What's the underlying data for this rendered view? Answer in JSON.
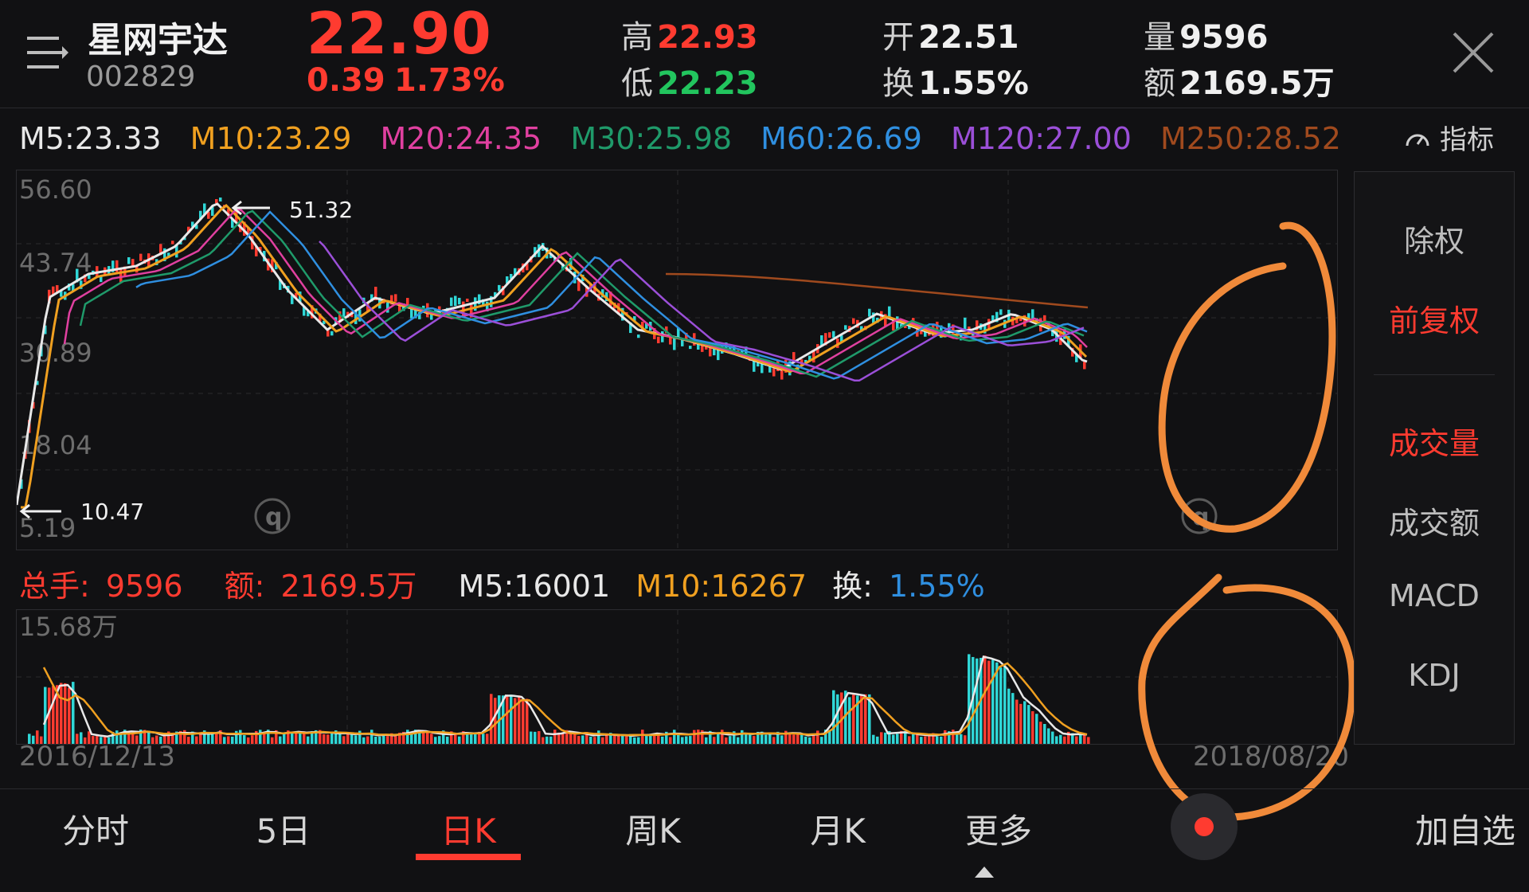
{
  "stock": {
    "name": "星网宇达",
    "code": "002829",
    "price": "22.90",
    "change": "0.39",
    "change_pct": "1.73%"
  },
  "quote": {
    "high_label": "高",
    "high": "22.93",
    "low_label": "低",
    "low": "22.23",
    "open_label": "开",
    "open": "22.51",
    "turnover_label": "换",
    "turnover": "1.55%",
    "volume_label": "量",
    "volume": "9596",
    "amount_label": "额",
    "amount": "2169.5万"
  },
  "ma": [
    {
      "text": "M5:23.33",
      "color": "#e8e8e8"
    },
    {
      "text": "M10:23.29",
      "color": "#f0a020"
    },
    {
      "text": "M20:24.35",
      "color": "#e040a0"
    },
    {
      "text": "M30:25.98",
      "color": "#1f9a6a"
    },
    {
      "text": "M60:26.69",
      "color": "#2f8fe0"
    },
    {
      "text": "M120:27.00",
      "color": "#9b4fd8"
    },
    {
      "text": "M250:28.52",
      "color": "#a04a1e"
    }
  ],
  "indicator_label": "指标",
  "price_axis": [
    "56.60",
    "43.74",
    "30.89",
    "18.04",
    "5.19"
  ],
  "annotations": {
    "high_mark": "51.32",
    "low_mark": "10.47"
  },
  "volume_stats": {
    "total_label": "总手:",
    "total": "9596",
    "amount_label": "额:",
    "amount": "2169.5万",
    "m5": "M5:16001",
    "m10": "M10:16267",
    "turn_label": "换:",
    "turn": "1.55%"
  },
  "volume_axis_max": "15.68万",
  "date_start": "2016/12/13",
  "date_end": "2018/08/20",
  "side_menu": [
    {
      "label": "除权",
      "active": false
    },
    {
      "label": "前复权",
      "active": true
    },
    {
      "label": "成交量",
      "active": true
    },
    {
      "label": "成交额",
      "active": false
    },
    {
      "label": "MACD",
      "active": false
    },
    {
      "label": "KDJ",
      "active": false
    }
  ],
  "tabs": [
    "分时",
    "5日",
    "日K",
    "周K",
    "月K",
    "更多"
  ],
  "add_watchlist": "加自选",
  "colors": {
    "up": "#ff3b30",
    "down": "#2fd6d6",
    "accent": "#ff3b30",
    "annotation": "#f08a3a"
  }
}
